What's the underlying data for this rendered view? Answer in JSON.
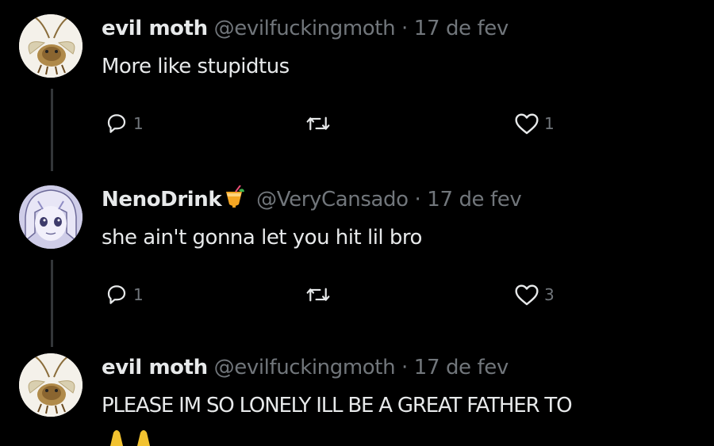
{
  "tweets": [
    {
      "name": "evil moth",
      "handle": "@evilfuckingmoth",
      "separator": "·",
      "time": "17 de fev",
      "text": "More like stupidtus",
      "replies": "1",
      "retweets": "",
      "likes": "1",
      "avatar_icon": "moth-avatar"
    },
    {
      "name": "NenoDrink",
      "name_emoji": "tropical-drink-emoji",
      "handle": "@VeryCansado",
      "separator": "·",
      "time": "17 de fev",
      "text": "she ain't gonna let you hit lil bro",
      "replies": "1",
      "retweets": "",
      "likes": "3",
      "avatar_icon": "anime-girl-avatar"
    },
    {
      "name": "evil moth",
      "handle": "@evilfuckingmoth",
      "separator": "·",
      "time": "17 de fev",
      "text": "PLEASE IM SO LONELY ILL BE A GREAT FATHER TO",
      "avatar_icon": "moth-avatar"
    }
  ],
  "colors": {
    "background": "#000000",
    "text": "#e7e9ea",
    "secondary": "#71767b",
    "thread_line": "#333639"
  }
}
